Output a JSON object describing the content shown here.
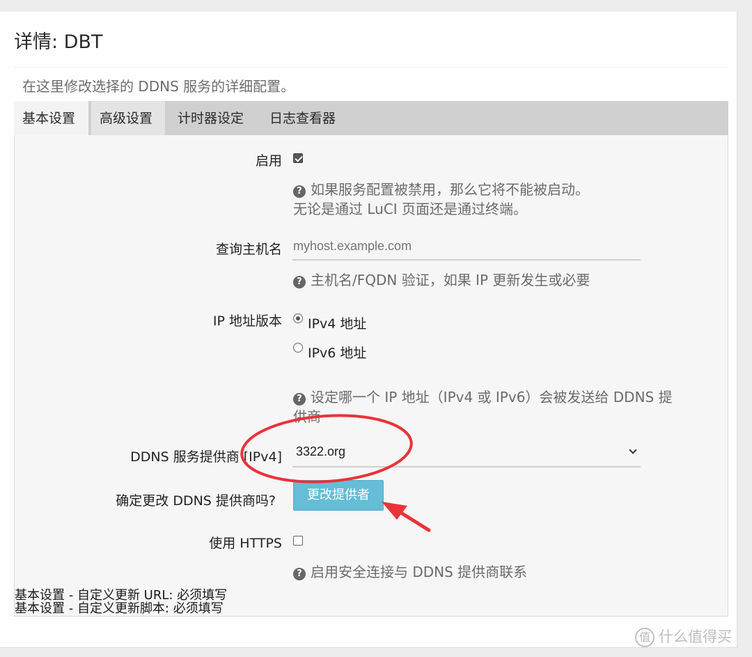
{
  "page": {
    "title": "详情: DBT",
    "description": "在这里修改选择的 DDNS 服务的详细配置。"
  },
  "tabs": [
    {
      "label": "基本设置",
      "active": true
    },
    {
      "label": "高级设置",
      "active": false
    },
    {
      "label": "计时器设定",
      "active": false
    },
    {
      "label": "日志查看器",
      "active": false
    }
  ],
  "form": {
    "enable": {
      "label": "启用",
      "checked": true,
      "help_line1": "如果服务配置被禁用，那么它将不能被启动。",
      "help_line2": "无论是通过 LuCI 页面还是通过终端。"
    },
    "lookup_host": {
      "label": "查询主机名",
      "placeholder": "myhost.example.com",
      "help": "主机名/FQDN 验证，如果 IP 更新发生或必要"
    },
    "ip_version": {
      "label": "IP 地址版本",
      "option_ipv4": "IPv4 地址",
      "option_ipv6": "IPv6 地址",
      "selected": "IPv4 地址",
      "help_line1": "设定哪一个 IP 地址（IPv4 或 IPv6）会被发送给 DDNS 提",
      "help_line2": "供商"
    },
    "provider": {
      "label": "DDNS 服务提供商 [IPv4]",
      "value": "3322.org"
    },
    "change_provider": {
      "label": "确定更改 DDNS 提供商吗?",
      "button": "更改提供者"
    },
    "use_https": {
      "label": "使用 HTTPS",
      "checked": false,
      "help": "启用安全连接与 DDNS 提供商联系"
    }
  },
  "validation": {
    "line1": "基本设置 - 自定义更新 URL: 必须填写",
    "line2": "基本设置 - 自定义更新脚本: 必须填写"
  },
  "watermark": {
    "icon_text": "值",
    "text": "什么值得买"
  },
  "annotation_color": "#e8333a",
  "help_icon_glyph": "?"
}
